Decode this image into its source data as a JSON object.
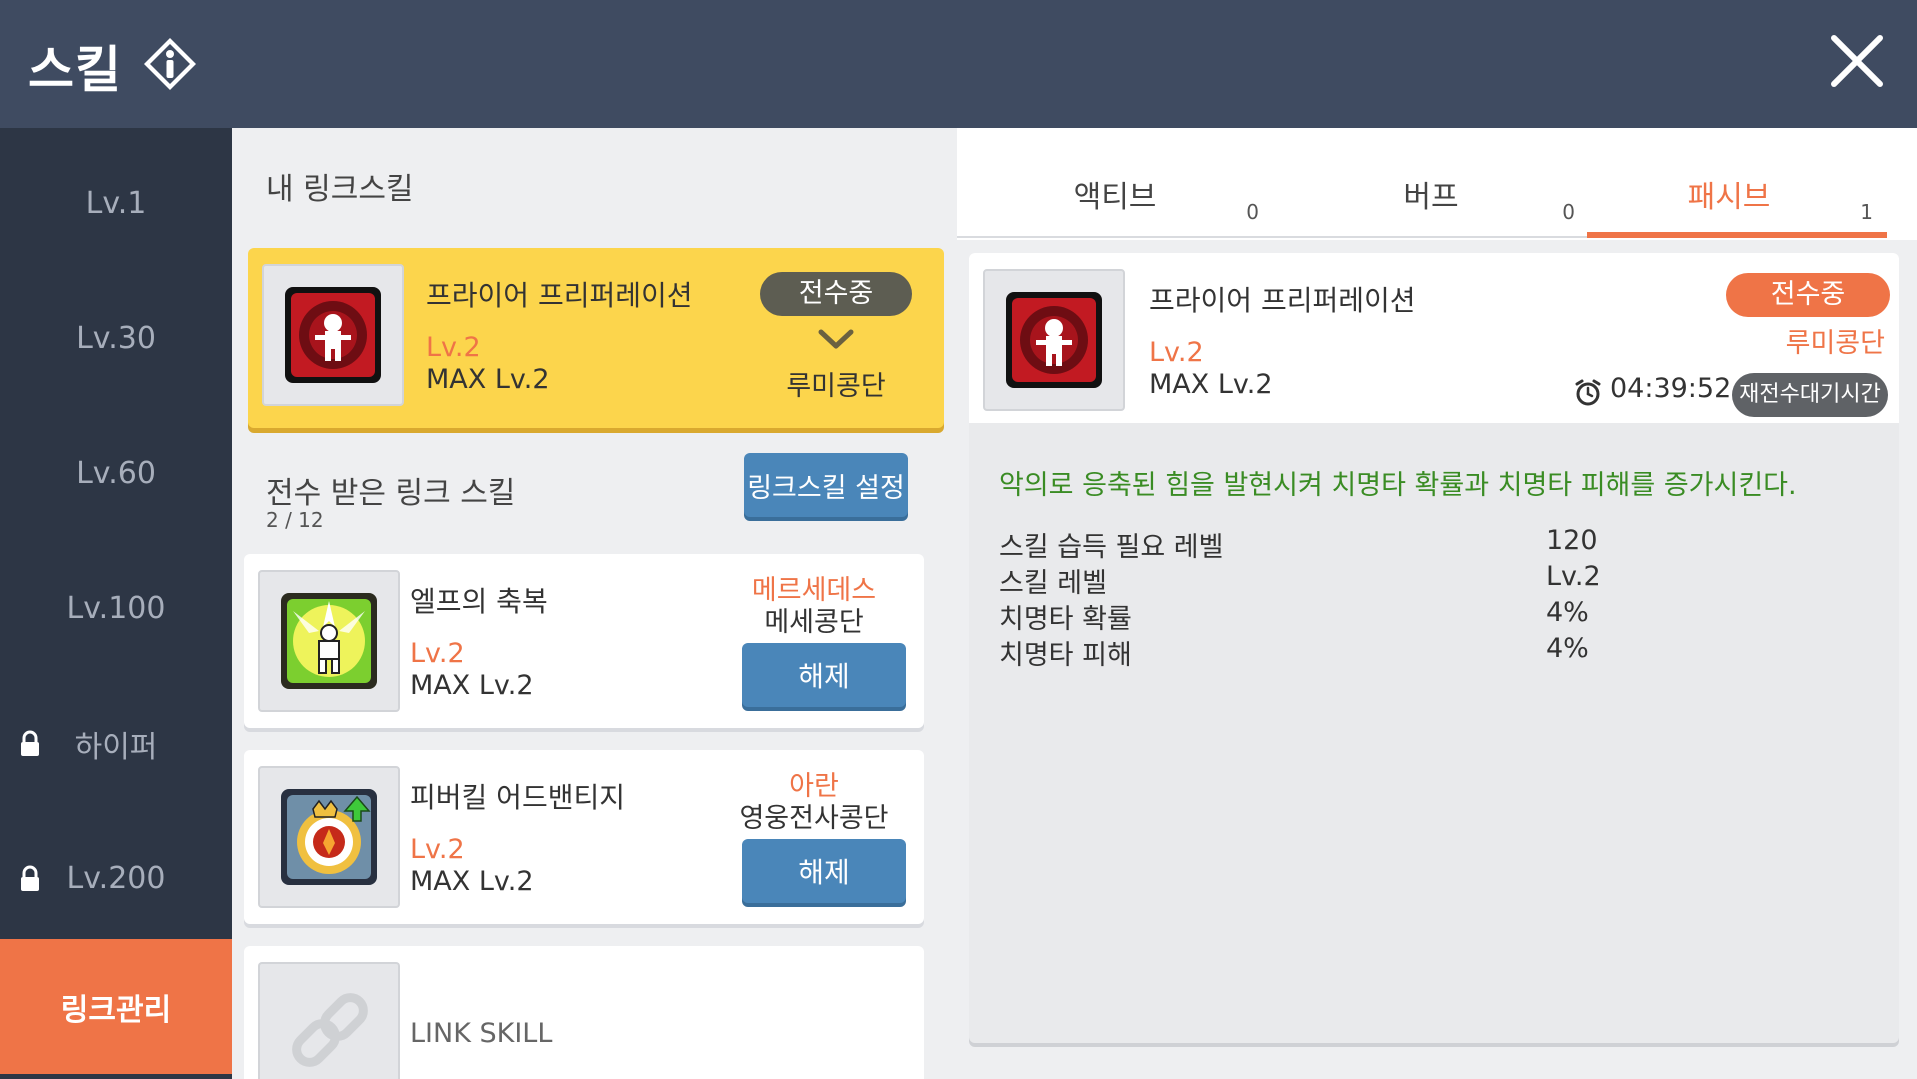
{
  "header": {
    "title": "스킬",
    "info_icon": "info-diamond-icon",
    "close_icon": "close-icon"
  },
  "sidebar": {
    "items": [
      {
        "label": "Lv.1",
        "locked": false
      },
      {
        "label": "Lv.30",
        "locked": false
      },
      {
        "label": "Lv.60",
        "locked": false
      },
      {
        "label": "Lv.100",
        "locked": false
      },
      {
        "label": "하이퍼",
        "locked": true
      },
      {
        "label": "Lv.200",
        "locked": true
      },
      {
        "label": "링크관리",
        "locked": false,
        "active": true
      }
    ]
  },
  "my_link": {
    "title": "내 링크스킬",
    "skill": {
      "name": "프라이어 프리퍼레이션",
      "level": "Lv.2",
      "max_level": "MAX Lv.2",
      "status": "전수중",
      "guild": "루미콩단"
    }
  },
  "received": {
    "title": "전수 받은 링크 스킬",
    "count": "2 / 12",
    "settings_button": "링크스킬 설정",
    "skills": [
      {
        "name": "엘프의 축복",
        "level": "Lv.2",
        "max_level": "MAX Lv.2",
        "character": "메르세데스",
        "guild": "메세콩단",
        "button": "해제"
      },
      {
        "name": "피버킬 어드밴티지",
        "level": "Lv.2",
        "max_level": "MAX Lv.2",
        "character": "아란",
        "guild": "영웅전사콩단",
        "button": "해제"
      }
    ],
    "empty_slot_label": "LINK SKILL"
  },
  "tabs": [
    {
      "label": "액티브",
      "count": "0"
    },
    {
      "label": "버프",
      "count": "0"
    },
    {
      "label": "패시브",
      "count": "1",
      "active": true
    }
  ],
  "detail": {
    "name": "프라이어 프리퍼레이션",
    "level": "Lv.2",
    "max_level": "MAX Lv.2",
    "status": "전수중",
    "guild": "루미콩단",
    "timer": "04:39:52",
    "wait_label": "재전수대기시간",
    "description": "악의로 응축된 힘을 발현시켜 치명타 확률과 치명타 피해를 증가시킨다.",
    "stats": [
      {
        "label": "스킬 습득 필요 레벨",
        "value": "120"
      },
      {
        "label": "스킬 레벨",
        "value": "Lv.2"
      },
      {
        "label": "치명타 확률",
        "value": "4%"
      },
      {
        "label": "치명타 피해",
        "value": "4%"
      }
    ]
  },
  "colors": {
    "header": "#3f4b61",
    "sidebar": "#2d3645",
    "accent": "#ef7447",
    "highlight": "#fcd54c",
    "button": "#4a86b9",
    "description": "#3a8c24"
  }
}
